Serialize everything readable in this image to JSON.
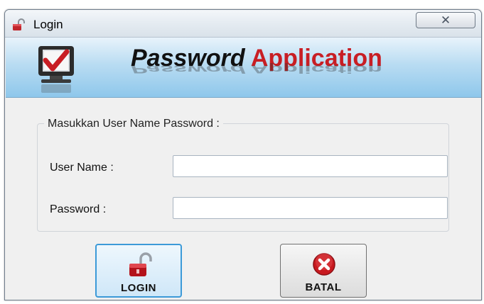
{
  "window": {
    "title": "Login",
    "close_symbol": "✕"
  },
  "banner": {
    "title_part1": "Password",
    "title_part2": "Application",
    "icon": "computer-check-icon"
  },
  "form": {
    "group_label": "Masukkan User Name  Password :",
    "username_label": "User Name :",
    "username_value": "",
    "password_label": "Password  :",
    "password_value": ""
  },
  "buttons": {
    "login_label": "LOGIN",
    "login_icon": "unlocked-padlock-icon",
    "cancel_label": "BATAL",
    "cancel_icon": "red-x-circle-icon"
  },
  "colors": {
    "accent_red": "#c81e24",
    "banner_blue": "#8ec7eb",
    "button_focus": "#3c9ad8"
  }
}
